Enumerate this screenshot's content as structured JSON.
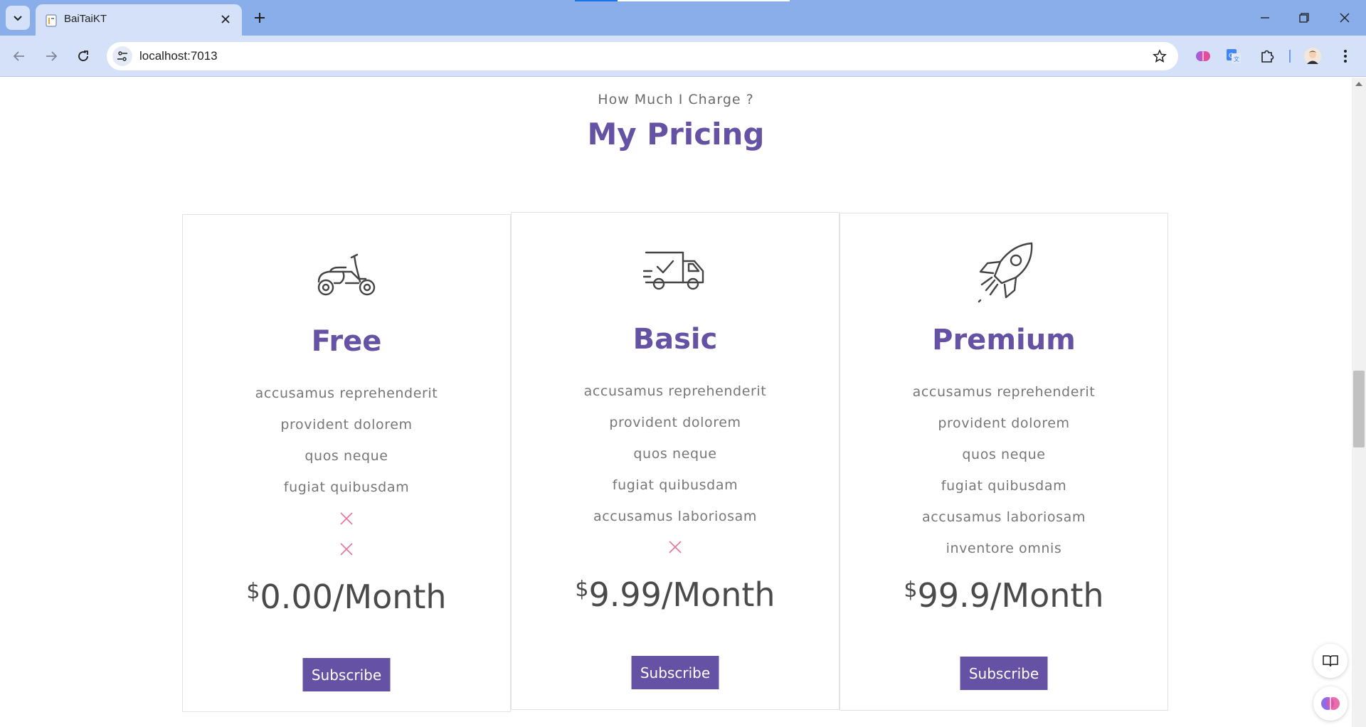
{
  "browser": {
    "tab_title": "BaiTaiKT",
    "url": "localhost:7013"
  },
  "section": {
    "subtitle": "How Much I Charge ?",
    "title": "My Pricing"
  },
  "plans": [
    {
      "icon": "scooter-icon",
      "name": "Free",
      "features": [
        "accusamus reprehenderit",
        "provident dolorem",
        "quos neque",
        "fugiat quibusdam"
      ],
      "unavailable_count": 2,
      "currency": "$",
      "price": "0.00/Month",
      "button": "Subscribe"
    },
    {
      "icon": "delivery-truck-icon",
      "name": "Basic",
      "features": [
        "accusamus reprehenderit",
        "provident dolorem",
        "quos neque",
        "fugiat quibusdam",
        "accusamus laboriosam"
      ],
      "unavailable_count": 1,
      "currency": "$",
      "price": "9.99/Month",
      "button": "Subscribe"
    },
    {
      "icon": "rocket-icon",
      "name": "Premium",
      "features": [
        "accusamus reprehenderit",
        "provident dolorem",
        "quos neque",
        "fugiat quibusdam",
        "accusamus laboriosam",
        "inventore omnis"
      ],
      "unavailable_count": 0,
      "currency": "$",
      "price": "99.9/Month",
      "button": "Subscribe"
    }
  ],
  "colors": {
    "accent": "#6652a4",
    "unavailable": "#e8739a",
    "tabbar": "#8aaeea",
    "toolbar": "#d4e1f8"
  }
}
